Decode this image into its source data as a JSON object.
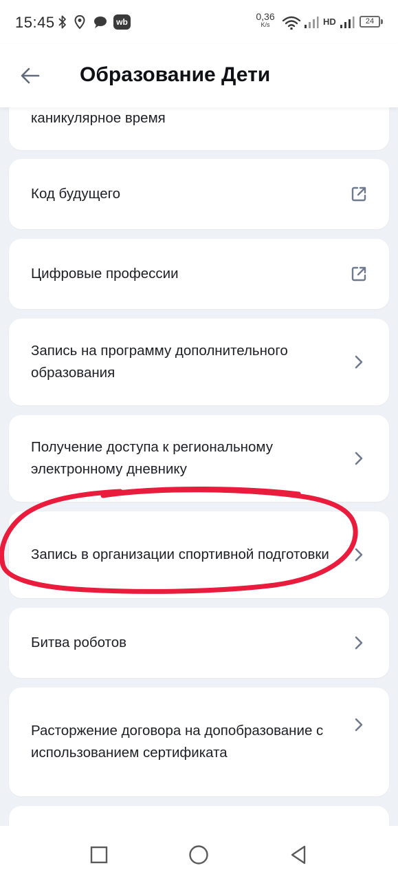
{
  "status_bar": {
    "time": "15:45",
    "net_speed_value": "0,36",
    "net_speed_unit": "K/s",
    "hd": "HD",
    "battery": "24",
    "wb": "wb"
  },
  "header": {
    "title": "Образование Дети"
  },
  "items": [
    {
      "label": "каникулярное время",
      "icon": "none"
    },
    {
      "label": "Код будущего",
      "icon": "external-link-icon"
    },
    {
      "label": "Цифровые профессии",
      "icon": "external-link-icon"
    },
    {
      "label": "Запись на программу дополнительного образования",
      "icon": "chevron-right-icon"
    },
    {
      "label": "Получение доступа к региональному электронному дневнику",
      "icon": "chevron-right-icon"
    },
    {
      "label": "Запись в организации спортивной подготовки",
      "icon": "chevron-right-icon"
    },
    {
      "label": "Битва роботов",
      "icon": "chevron-right-icon"
    },
    {
      "label": "Расторжение договора на допобразование с использованием сертификата",
      "icon": "chevron-right-icon"
    },
    {
      "label": "",
      "icon": "none"
    }
  ],
  "colors": {
    "background": "#eef1f6",
    "card": "#ffffff",
    "icon_gray": "#6f7a8c",
    "annotation_red": "#ea1c3d"
  }
}
